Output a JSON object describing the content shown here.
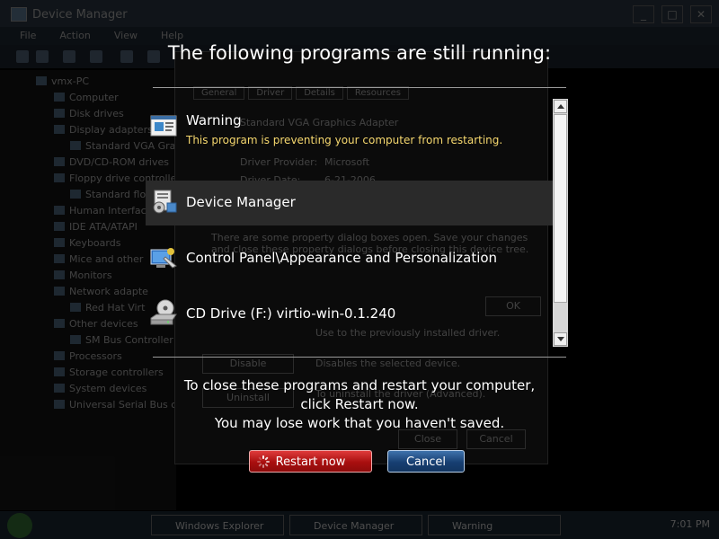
{
  "background": {
    "window_title": "Device Manager",
    "menu": [
      "File",
      "Action",
      "View",
      "Help"
    ],
    "tree": [
      "vmx-PC",
      "Computer",
      "Disk drives",
      "Display adapters",
      "Standard VGA Grap",
      "DVD/CD-ROM drives",
      "Floppy drive controlle",
      "Standard flo",
      "Human Interface",
      "IDE ATA/ATAPI",
      "Keyboards",
      "Mice and other",
      "Monitors",
      "Network adapte",
      "Red Hat Virt",
      "Other devices",
      "SM Bus Controller",
      "Processors",
      "Storage controllers",
      "System devices",
      "Universal Serial Bus co"
    ],
    "properties": {
      "tabs": [
        "General",
        "Driver",
        "Details",
        "Resources"
      ],
      "device_name": "Standard VGA Graphics Adapter",
      "provider_label": "Driver Provider:",
      "provider_value": "Microsoft",
      "date_label": "Driver Date:",
      "date_value": "6-21-2006",
      "notice": "There are some property dialog boxes open. Save your changes and close these property dialogs before closing this device tree.",
      "ok_label": "OK",
      "disable_label": "Disable",
      "disable_desc": "Disables the selected device.",
      "uninstall_label": "Uninstall",
      "uninstall_desc": "To uninstall the driver (Advanced).",
      "close_label": "Close",
      "cancel_label": "Cancel",
      "update_desc": "Use to the previously installed driver."
    },
    "taskbar": {
      "items": [
        "Windows Explorer",
        "Device Manager",
        "Warning"
      ],
      "clock": "7:01 PM"
    }
  },
  "dialog": {
    "heading": "The following programs are still running:",
    "items": [
      {
        "name": "Warning",
        "note": "This program is preventing your computer from restarting.",
        "icon": "warning-window-icon"
      },
      {
        "name": "Device Manager",
        "note": "",
        "icon": "device-manager-icon"
      },
      {
        "name": "Control Panel\\Appearance and Personalization",
        "note": "",
        "icon": "control-panel-icon"
      },
      {
        "name": "CD Drive (F:) virtio-win-0.1.240",
        "note": "",
        "icon": "cd-drive-icon"
      }
    ],
    "message_line1": "To close these programs and restart your computer,",
    "message_line2": "click Restart now.",
    "message_line3": "You may lose work that you haven't saved.",
    "restart_label": "Restart now",
    "cancel_label": "Cancel",
    "colors": {
      "note": "#f5d76e",
      "restart_button": "#b01515",
      "cancel_button": "#1f4a80"
    }
  }
}
